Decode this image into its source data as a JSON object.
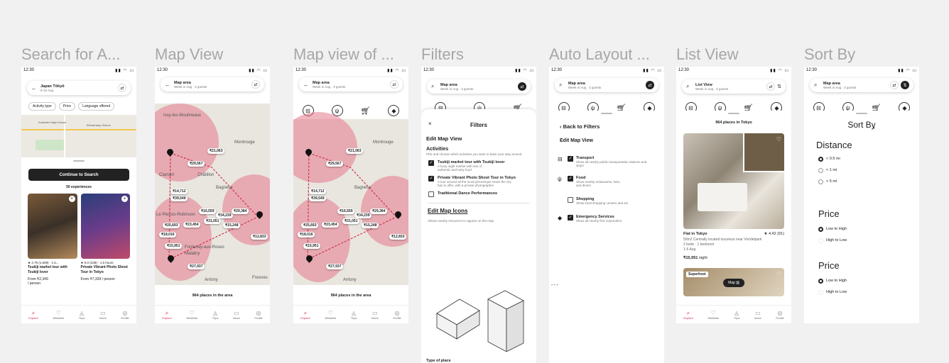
{
  "status_time": "12:30",
  "frames": {
    "search": {
      "title": "Search for A...",
      "pill_title": "Japan Tōkyō",
      "pill_sub": "8-15 Aug",
      "chips": [
        "Activity type",
        "Price",
        "Language offered"
      ],
      "map_labels": [
        "Konkeshi High School",
        "Elementary School"
      ],
      "button": "Continue to Search",
      "count": "50 experiences",
      "cards": [
        {
          "rating": "★ 4.79 (1,508) · 1.5...",
          "name": "Tsukiji market tour with Tsukiji lover",
          "price": "From ₹2,349",
          "unit": "/ person"
        },
        {
          "rating": "★ 5.0 (238) · 1.5 hours",
          "name": "Private Vibrant Photo Shoot Tour in Tokyo",
          "price": "From ₹7,339 / person",
          "unit": ""
        }
      ]
    },
    "map": {
      "title": "Map View",
      "pill_title": "Map area",
      "pill_sub": "Week in Aug · 3 guests",
      "footer": "964 places in the area"
    },
    "mapof": {
      "title": "Map view of ...",
      "pill_title": "Map area",
      "pill_sub": "Week in Aug · 3 guests",
      "footer": "964 places in the area"
    },
    "filters": {
      "title": "Filters",
      "pill_title": "Map area",
      "pill_sub": "Week in Aug · 3 guests",
      "sheet_title": "Filters",
      "section": "Edit Map View",
      "activities": "Activities",
      "activities_desc": "Pick and choose which activities you want to base your stay around",
      "items": [
        {
          "label": "Tsukiji market tour with Tsukiji lover",
          "desc": "A busy night market with lots of authentic and tasty food"
        },
        {
          "label": "Private Vibrant Photo Shoot Tour in Tokyo",
          "desc": "A tour around all the most picturesque views the city has to offer, with a private photographer"
        },
        {
          "label": "Traditional Dance Performances",
          "desc": ""
        }
      ],
      "icons_title": "Edit Map Icons",
      "icons_desc": "Allows nearby resources to appear on the map",
      "type_place": "Type of place"
    },
    "auto": {
      "title": "Auto Layout ...",
      "pill_title": "Map area",
      "pill_sub": "Week in Aug · 3 guests",
      "back": "Back to Filters",
      "section": "Edit Map View",
      "items": [
        {
          "label": "Transport",
          "desc": "Show all nearby public transportation stations and stops"
        },
        {
          "label": "Food",
          "desc": "Show nearby restaurants, bars, and diners"
        },
        {
          "label": "Shopping",
          "desc": "Show local shopping centers and sto"
        },
        {
          "label": "Emergency Services",
          "desc": "Show all nearby first responders"
        }
      ],
      "dots": "• • •"
    },
    "list": {
      "title": "List View",
      "pill_title": "List View",
      "pill_sub": "Week in Aug · 3 guests",
      "count": "964 places in Tokyo",
      "listing": {
        "name": "Flat in Tokyo",
        "rating": "★ 4.42 (91)",
        "desc": "50m2 Centrally located luxurious near Vondelpark",
        "beds": "2 beds · 1 bedroom",
        "dates": "1-6 Aug",
        "price": "₹15,951",
        "night": "night"
      },
      "badge": "Superhost",
      "mapbtn": "Map"
    },
    "sort": {
      "title": "Sort By",
      "pill_title": "Map area",
      "pill_sub": "Week in Aug · 3 guests",
      "sheet_title": "Sort By",
      "distance": "Distance",
      "d_opts": [
        "< 0.5 mi",
        "< 1 mi",
        "< 5 mi"
      ],
      "price1": "Price",
      "p1_opts": [
        "Low to High",
        "High to Low"
      ],
      "price2": "Price",
      "p2_opts": [
        "Low to High",
        "High to Low"
      ]
    }
  },
  "map_places": [
    "Issy-les-Moulineaux",
    "Montrouge",
    "Clamart",
    "Châtillon",
    "Bagneux",
    "Le Plessis-Robinson",
    "Fontenay-aux-Roses",
    "Malabry",
    "Antony",
    "Fresnes"
  ],
  "map_prices": [
    "₹21,063",
    "₹29,567",
    "₹14,712",
    "₹39,549",
    "₹16,559",
    "₹34,239",
    "₹29,384",
    "₹31,051",
    "₹25,693",
    "₹23,454",
    "₹15,248",
    "₹18,016",
    "₹12,833",
    "₹15,951",
    "₹27,937"
  ],
  "tabs": [
    "Explore",
    "Wishlists",
    "Trips",
    "Inbox",
    "Profile"
  ]
}
